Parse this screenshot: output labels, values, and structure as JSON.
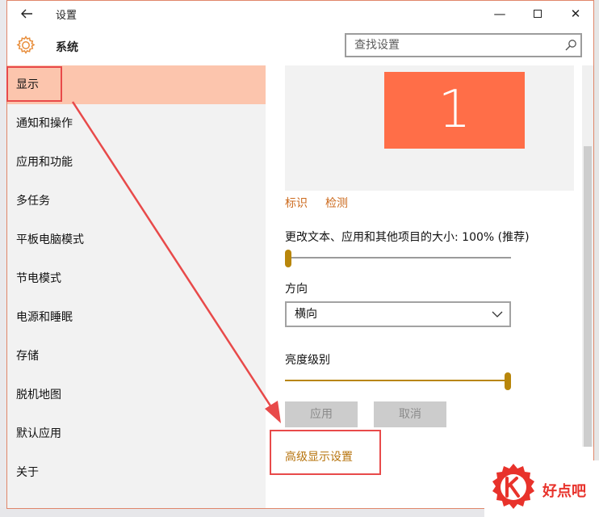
{
  "window": {
    "title": "设置",
    "controls": {
      "minimize": "—",
      "close": "✕"
    }
  },
  "header": {
    "section": "系统",
    "search_placeholder": "查找设置"
  },
  "sidebar": {
    "items": [
      {
        "label": "显示",
        "active": true
      },
      {
        "label": "通知和操作"
      },
      {
        "label": "应用和功能"
      },
      {
        "label": "多任务"
      },
      {
        "label": "平板电脑模式"
      },
      {
        "label": "节电模式"
      },
      {
        "label": "电源和睡眠"
      },
      {
        "label": "存储"
      },
      {
        "label": "脱机地图"
      },
      {
        "label": "默认应用"
      },
      {
        "label": "关于"
      }
    ]
  },
  "main": {
    "monitor_number": "1",
    "identify": "标识",
    "detect": "检测",
    "scale_label": "更改文本、应用和其他项目的大小: 100% (推荐)",
    "scale_slider_fraction": 0.0,
    "orientation_label": "方向",
    "orientation_value": "横向",
    "brightness_label": "亮度级别",
    "brightness_fraction": 1.0,
    "apply": "应用",
    "cancel": "取消",
    "advanced": "高级显示设置"
  },
  "watermark": {
    "text": "好点吧"
  },
  "colors": {
    "accent": "#ff6e48",
    "active_nav": "#fcc5ad",
    "link": "#cc6a1d",
    "slider": "#b8860b",
    "annotation": "#e84a4a"
  }
}
